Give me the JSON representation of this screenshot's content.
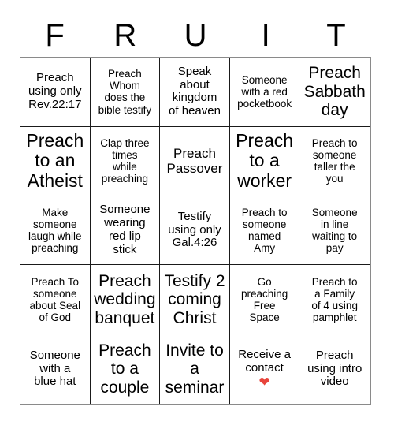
{
  "card": {
    "title_letters": [
      "F",
      "R",
      "U",
      "I",
      "T"
    ],
    "columns": 5,
    "rows": 5,
    "grid_border_color": "#8a8a8a",
    "cell_border_color": "#1a1a1a",
    "background_color": "#ffffff",
    "text_color": "#000000",
    "heart_color": "#e8453c",
    "cells": [
      {
        "text": "Preach\nusing only\nRev.22:17",
        "size": "sm",
        "marked": false
      },
      {
        "text": "Preach\nWhom\ndoes the\nbible testify",
        "size": "xs",
        "marked": false
      },
      {
        "text": "Speak\nabout\nkingdom\nof heaven",
        "size": "sm",
        "marked": false
      },
      {
        "text": "Someone\nwith a red\npocketbook",
        "size": "xs",
        "marked": false
      },
      {
        "text": "Preach\nSabbath\nday",
        "size": "lg",
        "marked": false
      },
      {
        "text": "Preach\nto an\nAtheist",
        "size": "xl",
        "marked": false
      },
      {
        "text": "Clap three\ntimes\nwhile\npreaching",
        "size": "xs",
        "marked": false
      },
      {
        "text": "Preach\nPassover",
        "size": "md",
        "marked": false
      },
      {
        "text": "Preach\nto a\nworker",
        "size": "xl",
        "marked": false
      },
      {
        "text": "Preach to\nsomeone\ntaller the\nyou",
        "size": "xs",
        "marked": false
      },
      {
        "text": "Make\nsomeone\nlaugh while\npreaching",
        "size": "xs",
        "marked": false
      },
      {
        "text": "Someone\nwearing\nred lip\nstick",
        "size": "sm",
        "marked": false
      },
      {
        "text": "Testify\nusing only\nGal.4:26",
        "size": "sm",
        "marked": false
      },
      {
        "text": "Preach to\nsomeone\nnamed\nAmy",
        "size": "xs",
        "marked": false
      },
      {
        "text": "Someone\nin line\nwaiting to\npay",
        "size": "xs",
        "marked": false
      },
      {
        "text": "Preach To\nsomeone\nabout Seal\nof God",
        "size": "xs",
        "marked": false
      },
      {
        "text": "Preach\nwedding\nbanquet",
        "size": "lg",
        "marked": false
      },
      {
        "text": "Testify 2\ncoming\nChrist",
        "size": "lg",
        "marked": false
      },
      {
        "text": "Go\npreaching\nFree\nSpace",
        "size": "xs",
        "marked": false,
        "free_space": true
      },
      {
        "text": "Preach to\na Family\nof 4 using\npamphlet",
        "size": "xs",
        "marked": false
      },
      {
        "text": "Someone\nwith a\nblue hat",
        "size": "sm",
        "marked": false
      },
      {
        "text": "Preach\nto a\ncouple",
        "size": "lg",
        "marked": false
      },
      {
        "text": "Invite to\na\nseminar",
        "size": "lg",
        "marked": false
      },
      {
        "text": "Receive a\ncontact",
        "size": "sm",
        "marked": true,
        "stamp": "❤"
      },
      {
        "text": "Preach\nusing intro\nvideo",
        "size": "sm",
        "marked": false
      }
    ]
  }
}
